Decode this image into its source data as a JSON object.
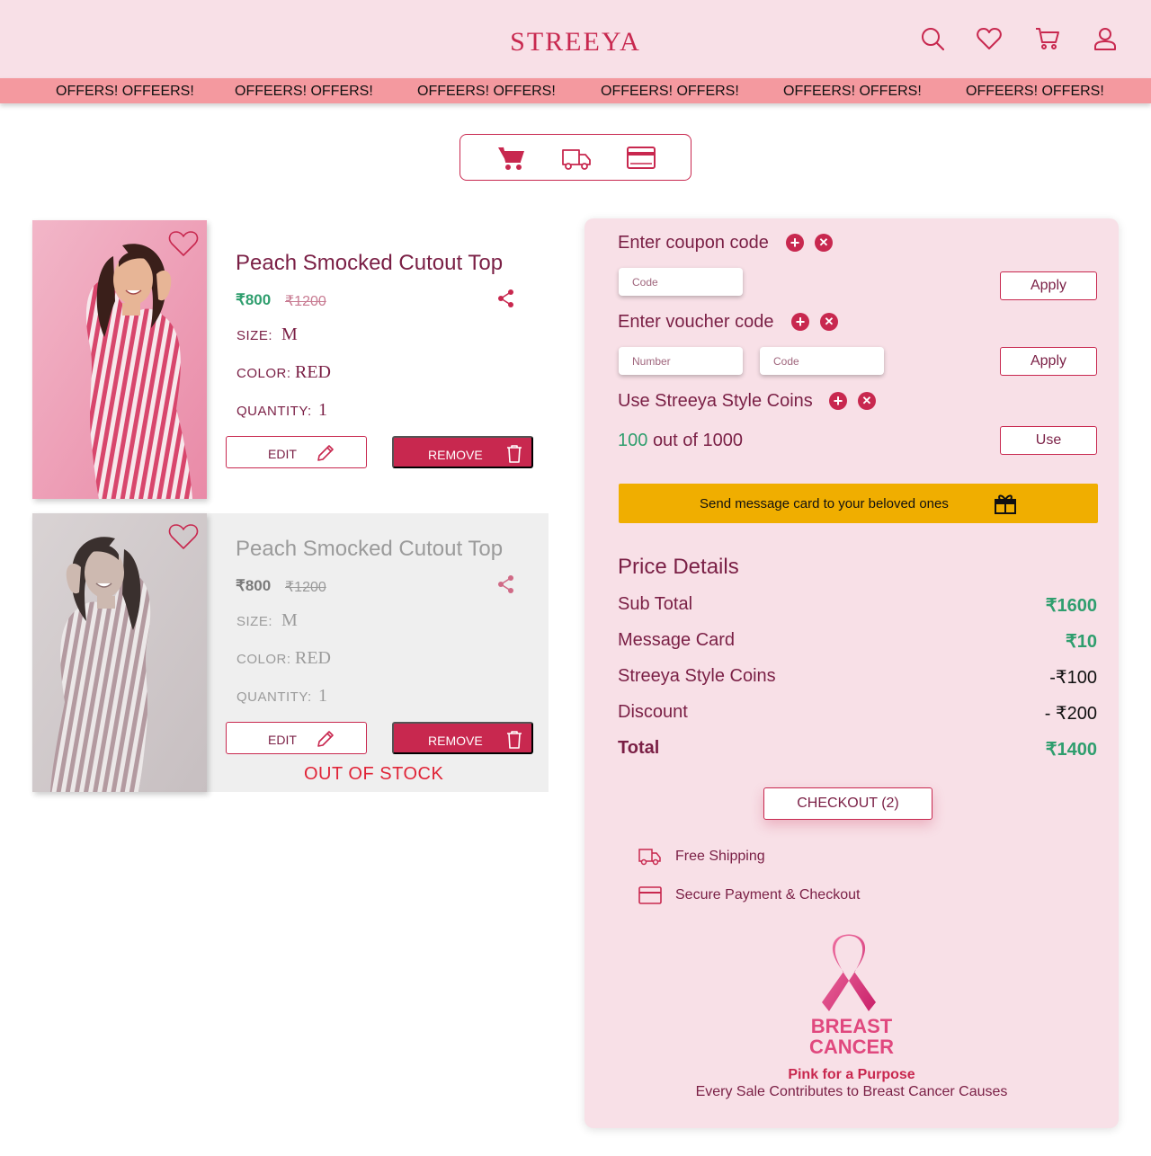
{
  "header": {
    "logo": "STREEYA",
    "icons": [
      "search-icon",
      "heart-icon",
      "cart-icon",
      "user-icon"
    ]
  },
  "offers": [
    "OFFERS! OFFEERS!",
    "OFFEERS! OFFERS!",
    "OFFEERS! OFFERS!",
    "OFFEERS! OFFERS!",
    "OFFEERS! OFFERS!",
    "OFFEERS! OFFERS!"
  ],
  "steps": [
    "cart-icon",
    "truck-icon",
    "card-icon"
  ],
  "products": [
    {
      "title": "Peach Smocked Cutout Top",
      "price": "₹800",
      "old_price": "₹1200",
      "size_label": "SIZE:",
      "size": "M",
      "color_label": "COLOR:",
      "color": "RED",
      "qty_label": "QUANTITY:",
      "qty": "1",
      "edit_label": "EDIT",
      "remove_label": "REMOVE",
      "in_stock": true
    },
    {
      "title": "Peach Smocked Cutout Top",
      "price": "₹800",
      "old_price": "₹1200",
      "size_label": "SIZE:",
      "size": "M",
      "color_label": "COLOR:",
      "color": "RED",
      "qty_label": "QUANTITY:",
      "qty": "1",
      "edit_label": "EDIT",
      "remove_label": "REMOVE",
      "in_stock": false,
      "status": "OUT OF STOCK"
    }
  ],
  "panel": {
    "coupon": {
      "label": "Enter coupon code",
      "placeholder": "Code",
      "button": "Apply"
    },
    "voucher": {
      "label": "Enter voucher code",
      "number_placeholder": "Number",
      "code_placeholder": "Code",
      "button": "Apply"
    },
    "coins": {
      "label": "Use Streeya Style Coins",
      "used": "100",
      "total_text": "out of 1000",
      "button": "Use"
    },
    "message_card": "Send message card to your beloved ones",
    "price_details": {
      "title": "Price Details",
      "rows": [
        {
          "label": "Sub Total",
          "value": "₹1600"
        },
        {
          "label": "Message Card",
          "value": "₹10"
        },
        {
          "label": "Streeya Style Coins",
          "value": "-₹100"
        },
        {
          "label": "Discount",
          "value": "- ₹200"
        }
      ],
      "total_label": "Total",
      "total_value": "₹1400"
    },
    "checkout": "CHECKOUT (2)",
    "features": [
      "Free Shipping",
      "Secure Payment & Checkout"
    ],
    "cause": {
      "logo_text": [
        "BREAST",
        "CANCER"
      ],
      "tagline": "Pink for a Purpose",
      "description": "Every Sale Contributes to Breast Cancer Causes"
    }
  },
  "colors": {
    "brand": "#c8284f",
    "header_bg": "#f8e0e7",
    "offer_bar": "#f4999f",
    "price_green": "#2f9e6e",
    "message_card": "#f0ae00",
    "ribbon": "#e0487e"
  }
}
